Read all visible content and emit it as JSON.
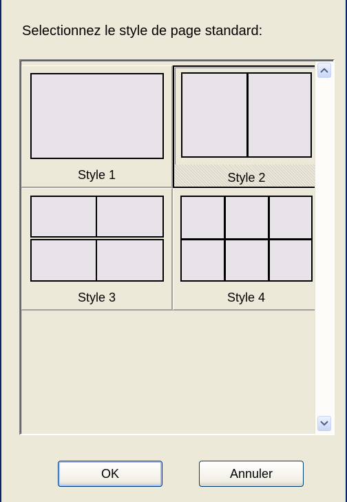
{
  "dialog": {
    "prompt": "Selectionnez le style de page standard:"
  },
  "styles": [
    {
      "label": "Style 1",
      "selected": false,
      "layout": "1x1"
    },
    {
      "label": "Style 2",
      "selected": true,
      "layout": "1x2"
    },
    {
      "label": "Style 3",
      "selected": false,
      "layout": "2x2"
    },
    {
      "label": "Style 4",
      "selected": false,
      "layout": "2x3"
    }
  ],
  "buttons": {
    "ok_label": "OK",
    "cancel_label": "Annuler"
  },
  "scrollbar": {
    "up_icon": "arrow-up-icon",
    "down_icon": "arrow-down-icon"
  }
}
